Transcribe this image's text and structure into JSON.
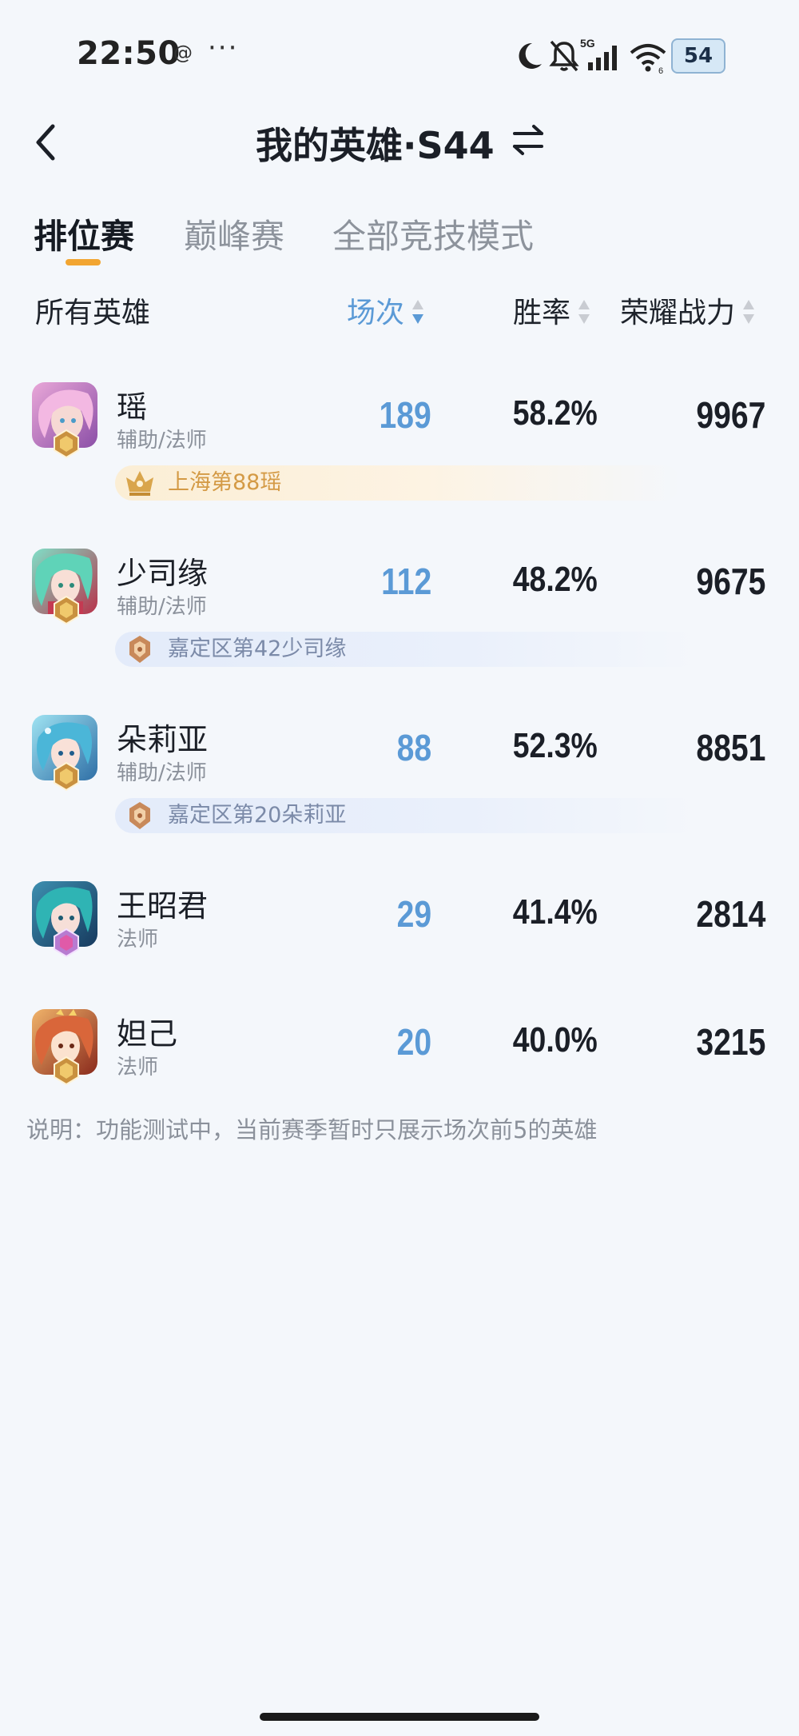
{
  "status_bar": {
    "time": "22:50",
    "at_symbol": "@",
    "dots": "···",
    "network": "5G",
    "battery": "54",
    "icons": [
      "moon-icon",
      "bell-off-icon",
      "signal-icon",
      "wifi-icon",
      "battery-icon"
    ]
  },
  "header": {
    "title": "我的英雄·S44",
    "back_icon": "chevron-left-icon",
    "switch_icon": "swap-arrows-icon"
  },
  "tabs": [
    {
      "label": "排位赛",
      "active": true
    },
    {
      "label": "巅峰赛",
      "active": false
    },
    {
      "label": "全部竞技模式",
      "active": false
    }
  ],
  "columns": {
    "all_heroes": "所有英雄",
    "matches": "场次",
    "winrate": "胜率",
    "power": "荣耀战力"
  },
  "heroes": [
    {
      "name": "瑶",
      "role": "辅助/法师",
      "matches": "189",
      "winrate": "58.2%",
      "power": "9967",
      "badge": "上海第88瑶",
      "badge_tier": "gold"
    },
    {
      "name": "少司缘",
      "role": "辅助/法师",
      "matches": "112",
      "winrate": "48.2%",
      "power": "9675",
      "badge": "嘉定区第42少司缘",
      "badge_tier": "blue"
    },
    {
      "name": "朵莉亚",
      "role": "辅助/法师",
      "matches": "88",
      "winrate": "52.3%",
      "power": "8851",
      "badge": "嘉定区第20朵莉亚",
      "badge_tier": "blue"
    },
    {
      "name": "王昭君",
      "role": "法师",
      "matches": "29",
      "winrate": "41.4%",
      "power": "2814"
    },
    {
      "name": "妲己",
      "role": "法师",
      "matches": "20",
      "winrate": "40.0%",
      "power": "3215"
    }
  ],
  "footnote": "说明：功能测试中，当前赛季暂时只展示场次前5的英雄",
  "colors": {
    "accent_blue": "#5b9ad6",
    "tab_underline": "#f2a531",
    "gold_badge_text": "#d49a45",
    "blue_badge_text": "#7b8aa8",
    "background": "#f4f7fb"
  }
}
